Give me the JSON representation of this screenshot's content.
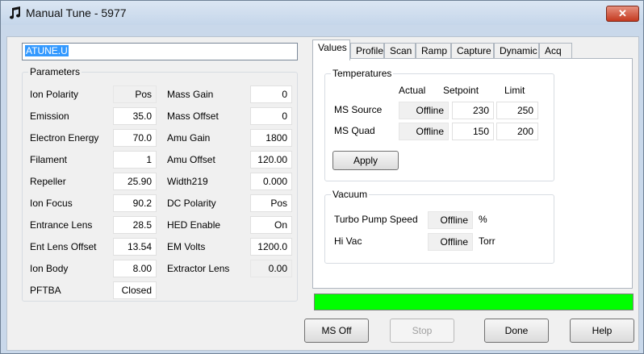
{
  "window": {
    "title": "Manual Tune - 5977",
    "close_glyph": "✕"
  },
  "file": {
    "value": "ATUNE.U"
  },
  "parameters": {
    "legend": "Parameters",
    "left": [
      {
        "label": "Ion Polarity",
        "value": "Pos",
        "readonly": true
      },
      {
        "label": "Emission",
        "value": "35.0",
        "readonly": false
      },
      {
        "label": "Electron Energy",
        "value": "70.0",
        "readonly": false
      },
      {
        "label": "Filament",
        "value": "1",
        "readonly": false
      },
      {
        "label": "Repeller",
        "value": "25.90",
        "readonly": false
      },
      {
        "label": "Ion Focus",
        "value": "90.2",
        "readonly": false
      },
      {
        "label": "Entrance Lens",
        "value": "28.5",
        "readonly": false
      },
      {
        "label": "Ent Lens Offset",
        "value": "13.54",
        "readonly": false
      },
      {
        "label": "Ion Body",
        "value": "8.00",
        "readonly": false
      },
      {
        "label": "PFTBA",
        "value": "Closed",
        "readonly": false
      }
    ],
    "right": [
      {
        "label": "Mass Gain",
        "value": "0",
        "readonly": false
      },
      {
        "label": "Mass Offset",
        "value": "0",
        "readonly": false
      },
      {
        "label": "Amu Gain",
        "value": "1800",
        "readonly": false
      },
      {
        "label": "Amu Offset",
        "value": "120.00",
        "readonly": false
      },
      {
        "label": "Width219",
        "value": "0.000",
        "readonly": false
      },
      {
        "label": "DC Polarity",
        "value": "Pos",
        "readonly": false
      },
      {
        "label": "HED Enable",
        "value": "On",
        "readonly": false
      },
      {
        "label": "EM Volts",
        "value": "1200.0",
        "readonly": false
      },
      {
        "label": "Extractor Lens",
        "value": "0.00",
        "readonly": true
      }
    ]
  },
  "tabs": [
    "Values",
    "Profile",
    "Scan",
    "Ramp",
    "Capture",
    "Dynamic",
    "Acq"
  ],
  "active_tab": "Values",
  "temperatures": {
    "legend": "Temperatures",
    "headers": {
      "actual": "Actual",
      "setpoint": "Setpoint",
      "limit": "Limit"
    },
    "rows": [
      {
        "label": "MS Source",
        "actual": "Offline",
        "setpoint": "230",
        "limit": "250"
      },
      {
        "label": "MS Quad",
        "actual": "Offline",
        "setpoint": "150",
        "limit": "200"
      }
    ],
    "apply_label": "Apply"
  },
  "vacuum": {
    "legend": "Vacuum",
    "rows": [
      {
        "label": "Turbo Pump Speed",
        "value": "Offline",
        "unit": "%"
      },
      {
        "label": "Hi Vac",
        "value": "Offline",
        "unit": "Torr"
      }
    ]
  },
  "progress": {
    "fraction": 1.0,
    "color": "#00ff00"
  },
  "buttons": {
    "ms_off": "MS Off",
    "stop": "Stop",
    "done": "Done",
    "help": "Help"
  },
  "colors": {
    "title_bg": "#c5d6ea",
    "close_bg": "#c4391f",
    "selection": "#3399ff"
  }
}
